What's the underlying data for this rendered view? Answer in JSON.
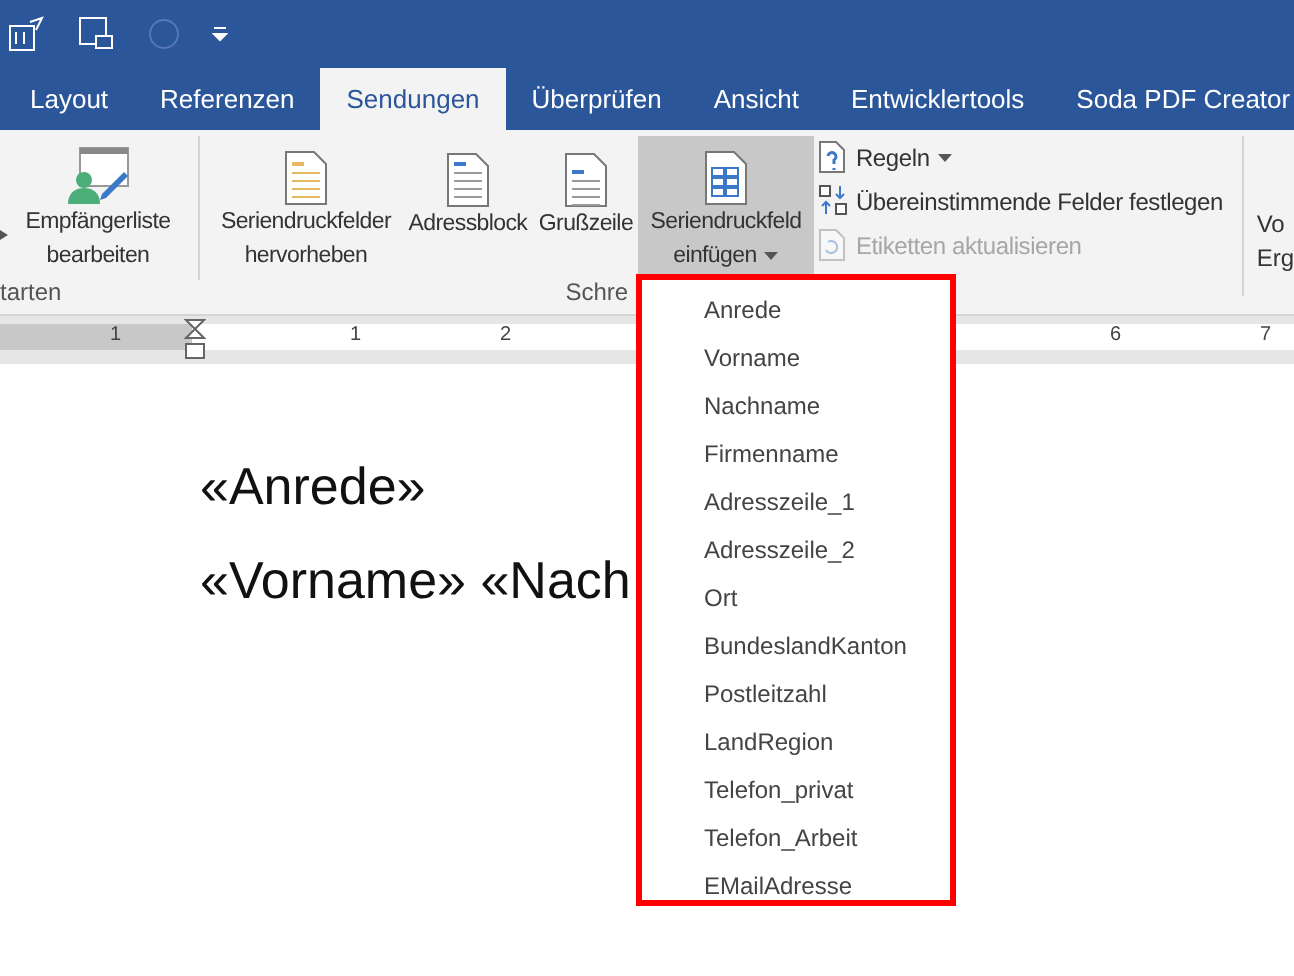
{
  "tabs": [
    {
      "label": "Layout",
      "selected": false
    },
    {
      "label": "Referenzen",
      "selected": false
    },
    {
      "label": "Sendungen",
      "selected": true
    },
    {
      "label": "Überprüfen",
      "selected": false
    },
    {
      "label": "Ansicht",
      "selected": false
    },
    {
      "label": "Entwicklertools",
      "selected": false
    },
    {
      "label": "Soda PDF Creator",
      "selected": false
    }
  ],
  "ribbon": {
    "large_buttons": [
      {
        "kind": "recipients",
        "label": "Empfängerliste bearbeiten",
        "pressed": false,
        "dropdown": false
      },
      {
        "kind": "highlight",
        "label": "Seriendruckfelder hervorheben",
        "pressed": false,
        "dropdown": false
      },
      {
        "kind": "address",
        "label": "Adressblock",
        "pressed": false,
        "dropdown": false
      },
      {
        "kind": "greeting",
        "label": "Grußzeile",
        "pressed": false,
        "dropdown": false
      },
      {
        "kind": "insert",
        "label": "Seriendruckfeld einfügen",
        "pressed": true,
        "dropdown": true
      }
    ],
    "small_buttons": [
      {
        "kind": "rules",
        "label": "Regeln",
        "disabled": false,
        "dropdown": true
      },
      {
        "kind": "match",
        "label": "Übereinstimmende Felder festlegen",
        "disabled": false,
        "dropdown": false
      },
      {
        "kind": "update",
        "label": "Etiketten aktualisieren",
        "disabled": true,
        "dropdown": false
      }
    ],
    "group_labels": [
      "tarten",
      "Schre"
    ],
    "cut_button_lines": [
      "Vo",
      "Erg"
    ]
  },
  "ruler": {
    "labels": [
      "1",
      "1",
      "2",
      "6",
      "7"
    ]
  },
  "document": {
    "lines": [
      "«Anrede»",
      "«Vorname» «Nach"
    ]
  },
  "field_menu": {
    "items": [
      "Anrede",
      "Vorname",
      "Nachname",
      "Firmenname",
      "Adresszeile_1",
      "Adresszeile_2",
      "Ort",
      "BundeslandKanton",
      "Postleitzahl",
      "LandRegion",
      "Telefon_privat",
      "Telefon_Arbeit",
      "EMailAdresse"
    ]
  }
}
